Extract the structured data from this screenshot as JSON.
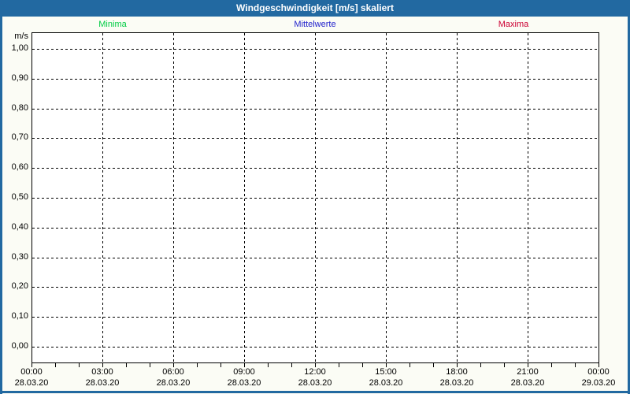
{
  "window": {
    "title": "Windgeschwindigkeit [m/s] skaliert",
    "titlebar_color": "#2269a1",
    "background_color": "#fbfcf5"
  },
  "legend": {
    "items": [
      {
        "label": "Minima",
        "color": "#00cc44"
      },
      {
        "label": "Mittelwerte",
        "color": "#2222cc"
      },
      {
        "label": "Maxima",
        "color": "#cc0033"
      }
    ]
  },
  "chart_data": {
    "type": "line",
    "title": "Windgeschwindigkeit [m/s] skaliert",
    "ylabel": "m/s",
    "ylim": [
      0.0,
      1.0
    ],
    "ytick_interval": 0.1,
    "y_tick_labels": [
      "1,00",
      "0,90",
      "0,80",
      "0,70",
      "0,60",
      "0,50",
      "0,40",
      "0,30",
      "0,20",
      "0,10",
      "0,00"
    ],
    "grid": "dashed",
    "legend_position": "top",
    "xtick_interval_hours": 3,
    "minor_xtick_interval_hours": 1,
    "x_axis": {
      "major_ticks": [
        {
          "time": "00:00",
          "date": "28.03.20"
        },
        {
          "time": "03:00",
          "date": "28.03.20"
        },
        {
          "time": "06:00",
          "date": "28.03.20"
        },
        {
          "time": "09:00",
          "date": "28.03.20"
        },
        {
          "time": "12:00",
          "date": "28.03.20"
        },
        {
          "time": "15:00",
          "date": "28.03.20"
        },
        {
          "time": "18:00",
          "date": "28.03.20"
        },
        {
          "time": "21:00",
          "date": "28.03.20"
        },
        {
          "time": "00:00",
          "date": "29.03.20"
        }
      ]
    },
    "series": [
      {
        "name": "Minima",
        "color": "#00cc44",
        "values": []
      },
      {
        "name": "Mittelwerte",
        "color": "#2222cc",
        "values": []
      },
      {
        "name": "Maxima",
        "color": "#cc0033",
        "values": []
      }
    ]
  }
}
